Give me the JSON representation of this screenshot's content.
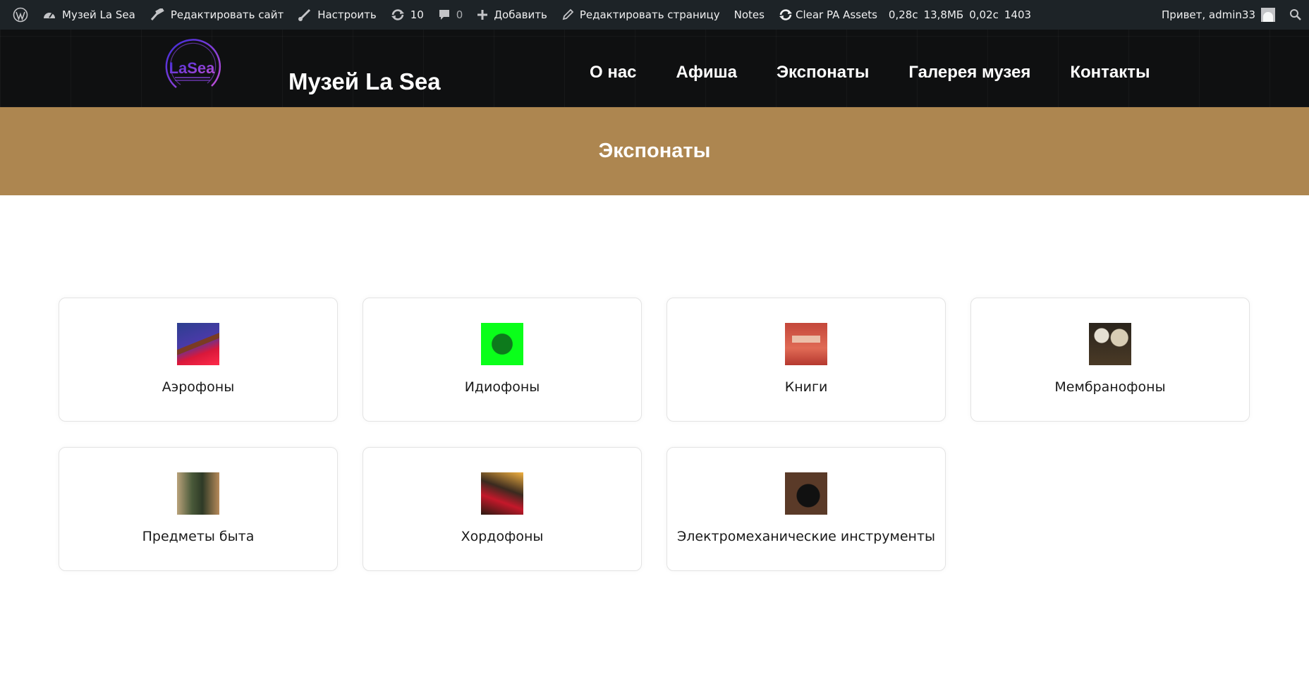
{
  "adminbar": {
    "wp_logo_icon": "wordpress-icon",
    "site_name": "Музей La Sea",
    "edit_site": "Редактировать сайт",
    "customize": "Настроить",
    "updates_count": "10",
    "comments_count": "0",
    "add_new": "Добавить",
    "edit_page": "Редактировать страницу",
    "notes": "Notes",
    "clear_assets": "Clear PA Assets",
    "stat_time": "0,28с",
    "stat_memory": "13,8МБ",
    "stat_query_time": "0,02с",
    "stat_queries": "1403",
    "greeting": "Привет, admin33"
  },
  "header": {
    "logo_text": "LaSea",
    "site_title": "Музей La Sea",
    "nav": [
      {
        "label": "О нас"
      },
      {
        "label": "Афиша"
      },
      {
        "label": "Экспонаты"
      },
      {
        "label": "Галерея музея"
      },
      {
        "label": "Контакты"
      }
    ]
  },
  "page": {
    "title": "Экспонаты"
  },
  "categories": [
    {
      "label": "Аэрофоны",
      "thumb": "aerophones-photo"
    },
    {
      "label": "Идиофоны",
      "thumb": "idiophones-photo"
    },
    {
      "label": "Книги",
      "thumb": "books-photo"
    },
    {
      "label": "Мембранофоны",
      "thumb": "membranophones-photo"
    },
    {
      "label": "Предметы быта",
      "thumb": "household-items-photo"
    },
    {
      "label": "Хордофоны",
      "thumb": "chordophones-photo"
    },
    {
      "label": "Электромеханические инструменты",
      "thumb": "electromechanical-photo"
    }
  ],
  "colors": {
    "adminbar_bg": "#1d2327",
    "header_bg": "#0f1011",
    "title_band": "#ad8650",
    "logo_accent": "#7b3fc9"
  }
}
